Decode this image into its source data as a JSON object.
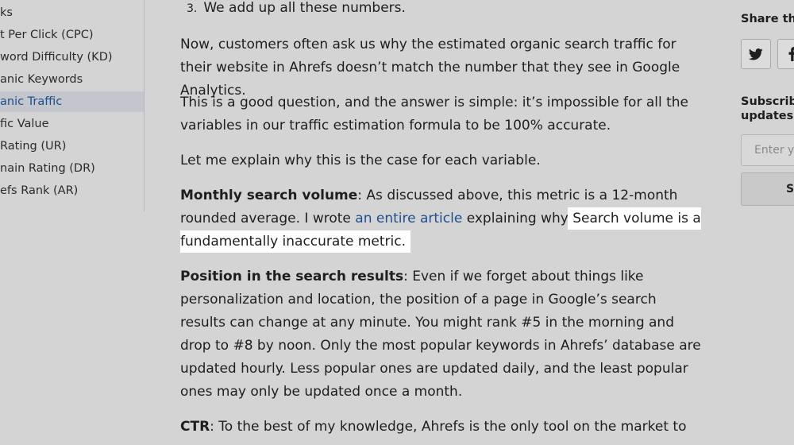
{
  "toc": {
    "items": [
      {
        "label": "ks"
      },
      {
        "label": "t Per Click (CPC)"
      },
      {
        "label": "word Difficulty (KD)"
      },
      {
        "label": "anic Keywords"
      },
      {
        "label": "anic Traffic",
        "active": true
      },
      {
        "label": "fic Value"
      },
      {
        "label": "Rating (UR)"
      },
      {
        "label": "nain Rating (DR)"
      },
      {
        "label": "efs Rank (AR)"
      }
    ]
  },
  "article": {
    "list_item": {
      "number": "3.",
      "text": "We add up all these numbers."
    },
    "p1": "Now, customers often ask us why the estimated organic search traffic for their website in Ahrefs doesn’t match the number that they see in Google Analytics.",
    "p2": "This is a good question, and the answer is simple: it’s impossible for all the variables in our traffic estimation formula to be 100% accurate.",
    "p3": "Let me explain why this is the case for each variable.",
    "p4": {
      "bold": "Monthly search volume",
      "text_before_link": ": As discussed above, this metric is a 12-month rounded average. I wrote ",
      "link": "an entire article",
      "text_after_link": " explaining why ",
      "highlight": "Search volume is a fundamentally inaccurate metric."
    },
    "p5": {
      "bold": "Position in the search results",
      "text": ": Even if we forget about things like personalization and location, the position of a page in Google’s search results can change at any minute. You might rank #5 in the morning and drop to #8 by noon. Only the most popular keywords in Ahrefs’ database are updated hourly. Less popular ones are updated daily, and the least popular ones may only be updated once a month."
    },
    "p6": {
      "bold": "CTR",
      "text": ": To the best of my knowledge, Ahrefs is the only tool on the market to"
    }
  },
  "sidebar_right": {
    "share_title": "Share this",
    "share_buttons": [
      {
        "icon": "twitter-icon"
      },
      {
        "icon": "facebook-icon"
      }
    ],
    "subscribe_title": "Subscribe\nupdates",
    "email_placeholder": "Enter yo",
    "subscribe_button": "S"
  },
  "colors": {
    "background": "#d4d4d4",
    "link": "#1d4f8c",
    "highlight": "#ffffff",
    "active_toc_bg": "#c3c6cc"
  }
}
